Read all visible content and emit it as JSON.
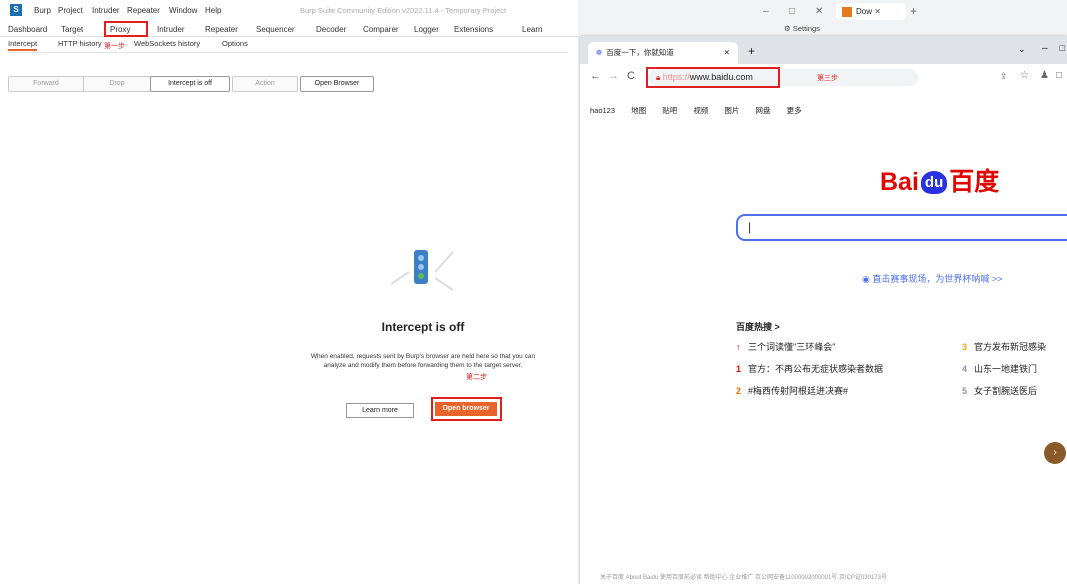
{
  "burp": {
    "app_logo": "S",
    "menu": [
      "Burp",
      "Project",
      "Intruder",
      "Repeater",
      "Window",
      "Help"
    ],
    "window_title": "Burp Suite Community Edition v2022.11.4 - Temporary Project",
    "tabs": [
      "Dashboard",
      "Target",
      "Proxy",
      "Intruder",
      "Repeater",
      "Sequencer",
      "Decoder",
      "Comparer",
      "Logger",
      "Extensions",
      "Learn"
    ],
    "settings": "Settings",
    "subtabs": [
      "Intercept",
      "HTTP history",
      "WebSockets history",
      "Options"
    ],
    "buttons": [
      "Forward",
      "Drop",
      "Intercept is off",
      "Action",
      "Open Browser"
    ],
    "intercept_title": "Intercept is off",
    "intercept_desc": "When enabled, requests sent by Burp's browser are held here so that you can analyze and modify them before forwarding them to the target server.",
    "learn_more": "Learn more",
    "open_browser": "Open browser",
    "annotation_step1": "第一步",
    "annotation_step2": "第二步"
  },
  "browser": {
    "tab_title": "百度一下，你就知道",
    "url_prefix": "https://",
    "url_rest": "www.baidu.com",
    "annotation_step3": "第三步",
    "nav_links": [
      "hao123",
      "地图",
      "贴吧",
      "视频",
      "图片",
      "网盘",
      "更多"
    ],
    "logo_text": "Bai",
    "logo_du": "du",
    "logo_cn": "百度",
    "hot_link": "直击赛事现场，为世界杯呐喊 >>",
    "hot_header": "百度热搜 >",
    "hot_items_left": [
      {
        "rank": "↑",
        "text": "三个词读懂\"三环峰会\""
      },
      {
        "rank": "1",
        "text": "官方：不再公布无症状感染者数据"
      },
      {
        "rank": "2",
        "text": "#梅西传射阿根廷进决赛#"
      }
    ],
    "hot_items_right": [
      {
        "rank": "3",
        "text": "官方发布新冠感染"
      },
      {
        "rank": "4",
        "text": "山东一地建铁门"
      },
      {
        "rank": "5",
        "text": "女子割腕送医后"
      }
    ],
    "footer": "关于百度  About Baidu  使用百度前必读  帮助中心  企业推广  京公网安备11000002000001号  京ICP证030173号",
    "other_tab": "Dow"
  },
  "colors": {
    "accent": "#e8642a",
    "annotation": "#e02020",
    "baidu_blue": "#4e6ef2",
    "baidu_red": "#e10601"
  }
}
